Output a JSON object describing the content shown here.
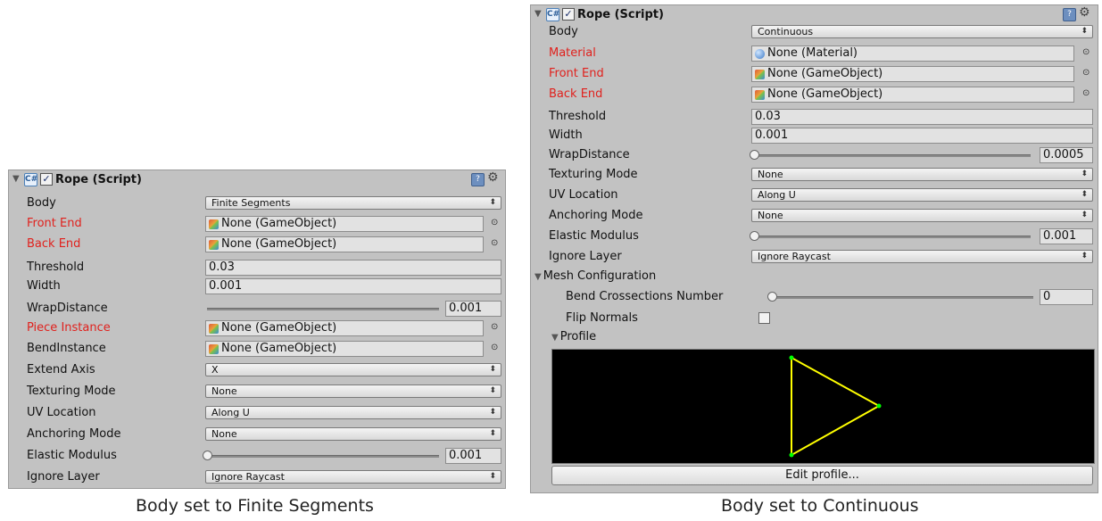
{
  "left": {
    "title": "Rope (Script)",
    "rows": {
      "body_label": "Body",
      "body_value": "Finite Segments",
      "front_label": "Front End",
      "front_value": "None (GameObject)",
      "back_label": "Back End",
      "back_value": "None (GameObject)",
      "threshold_label": "Threshold",
      "threshold_value": "0.03",
      "width_label": "Width",
      "width_value": "0.001",
      "wrap_label": "WrapDistance",
      "wrap_value": "0.001",
      "piece_label": "Piece Instance",
      "piece_value": "None (GameObject)",
      "bend_label": "BendInstance",
      "bend_value": "None (GameObject)",
      "extend_label": "Extend Axis",
      "extend_value": "X",
      "tex_label": "Texturing Mode",
      "tex_value": "None",
      "uv_label": "UV Location",
      "uv_value": "Along U",
      "anchor_label": "Anchoring Mode",
      "anchor_value": "None",
      "elastic_label": "Elastic Modulus",
      "elastic_value": "0.001",
      "ignore_label": "Ignore Layer",
      "ignore_value": "Ignore Raycast"
    },
    "caption": "Body set to Finite Segments"
  },
  "right": {
    "title": "Rope (Script)",
    "rows": {
      "body_label": "Body",
      "body_value": "Continuous",
      "material_label": "Material",
      "material_value": "None (Material)",
      "front_label": "Front End",
      "front_value": "None (GameObject)",
      "back_label": "Back End",
      "back_value": "None (GameObject)",
      "threshold_label": "Threshold",
      "threshold_value": "0.03",
      "width_label": "Width",
      "width_value": "0.001",
      "wrap_label": "WrapDistance",
      "wrap_value": "0.0005",
      "tex_label": "Texturing Mode",
      "tex_value": "None",
      "uv_label": "UV Location",
      "uv_value": "Along U",
      "anchor_label": "Anchoring Mode",
      "anchor_value": "None",
      "elastic_label": "Elastic Modulus",
      "elastic_value": "0.001",
      "ignore_label": "Ignore Layer",
      "ignore_value": "Ignore Raycast",
      "mesh_label": "Mesh Configuration",
      "bend_cross_label": "Bend Crossections Number",
      "bend_cross_value": "0",
      "flip_label": "Flip Normals",
      "profile_label": "Profile",
      "edit_profile_label": "Edit profile..."
    },
    "caption": "Body set to Continuous"
  },
  "colors": {
    "panel": "#c2c2c2",
    "missing_ref": "#e0211d",
    "profile_line": "#ffff00",
    "profile_point": "#00ff00"
  },
  "icons": {
    "foldout": "triangle-down-icon",
    "script": "script-icon",
    "help": "help-icon",
    "settings": "gear-icon",
    "picker": "object-picker-icon"
  }
}
